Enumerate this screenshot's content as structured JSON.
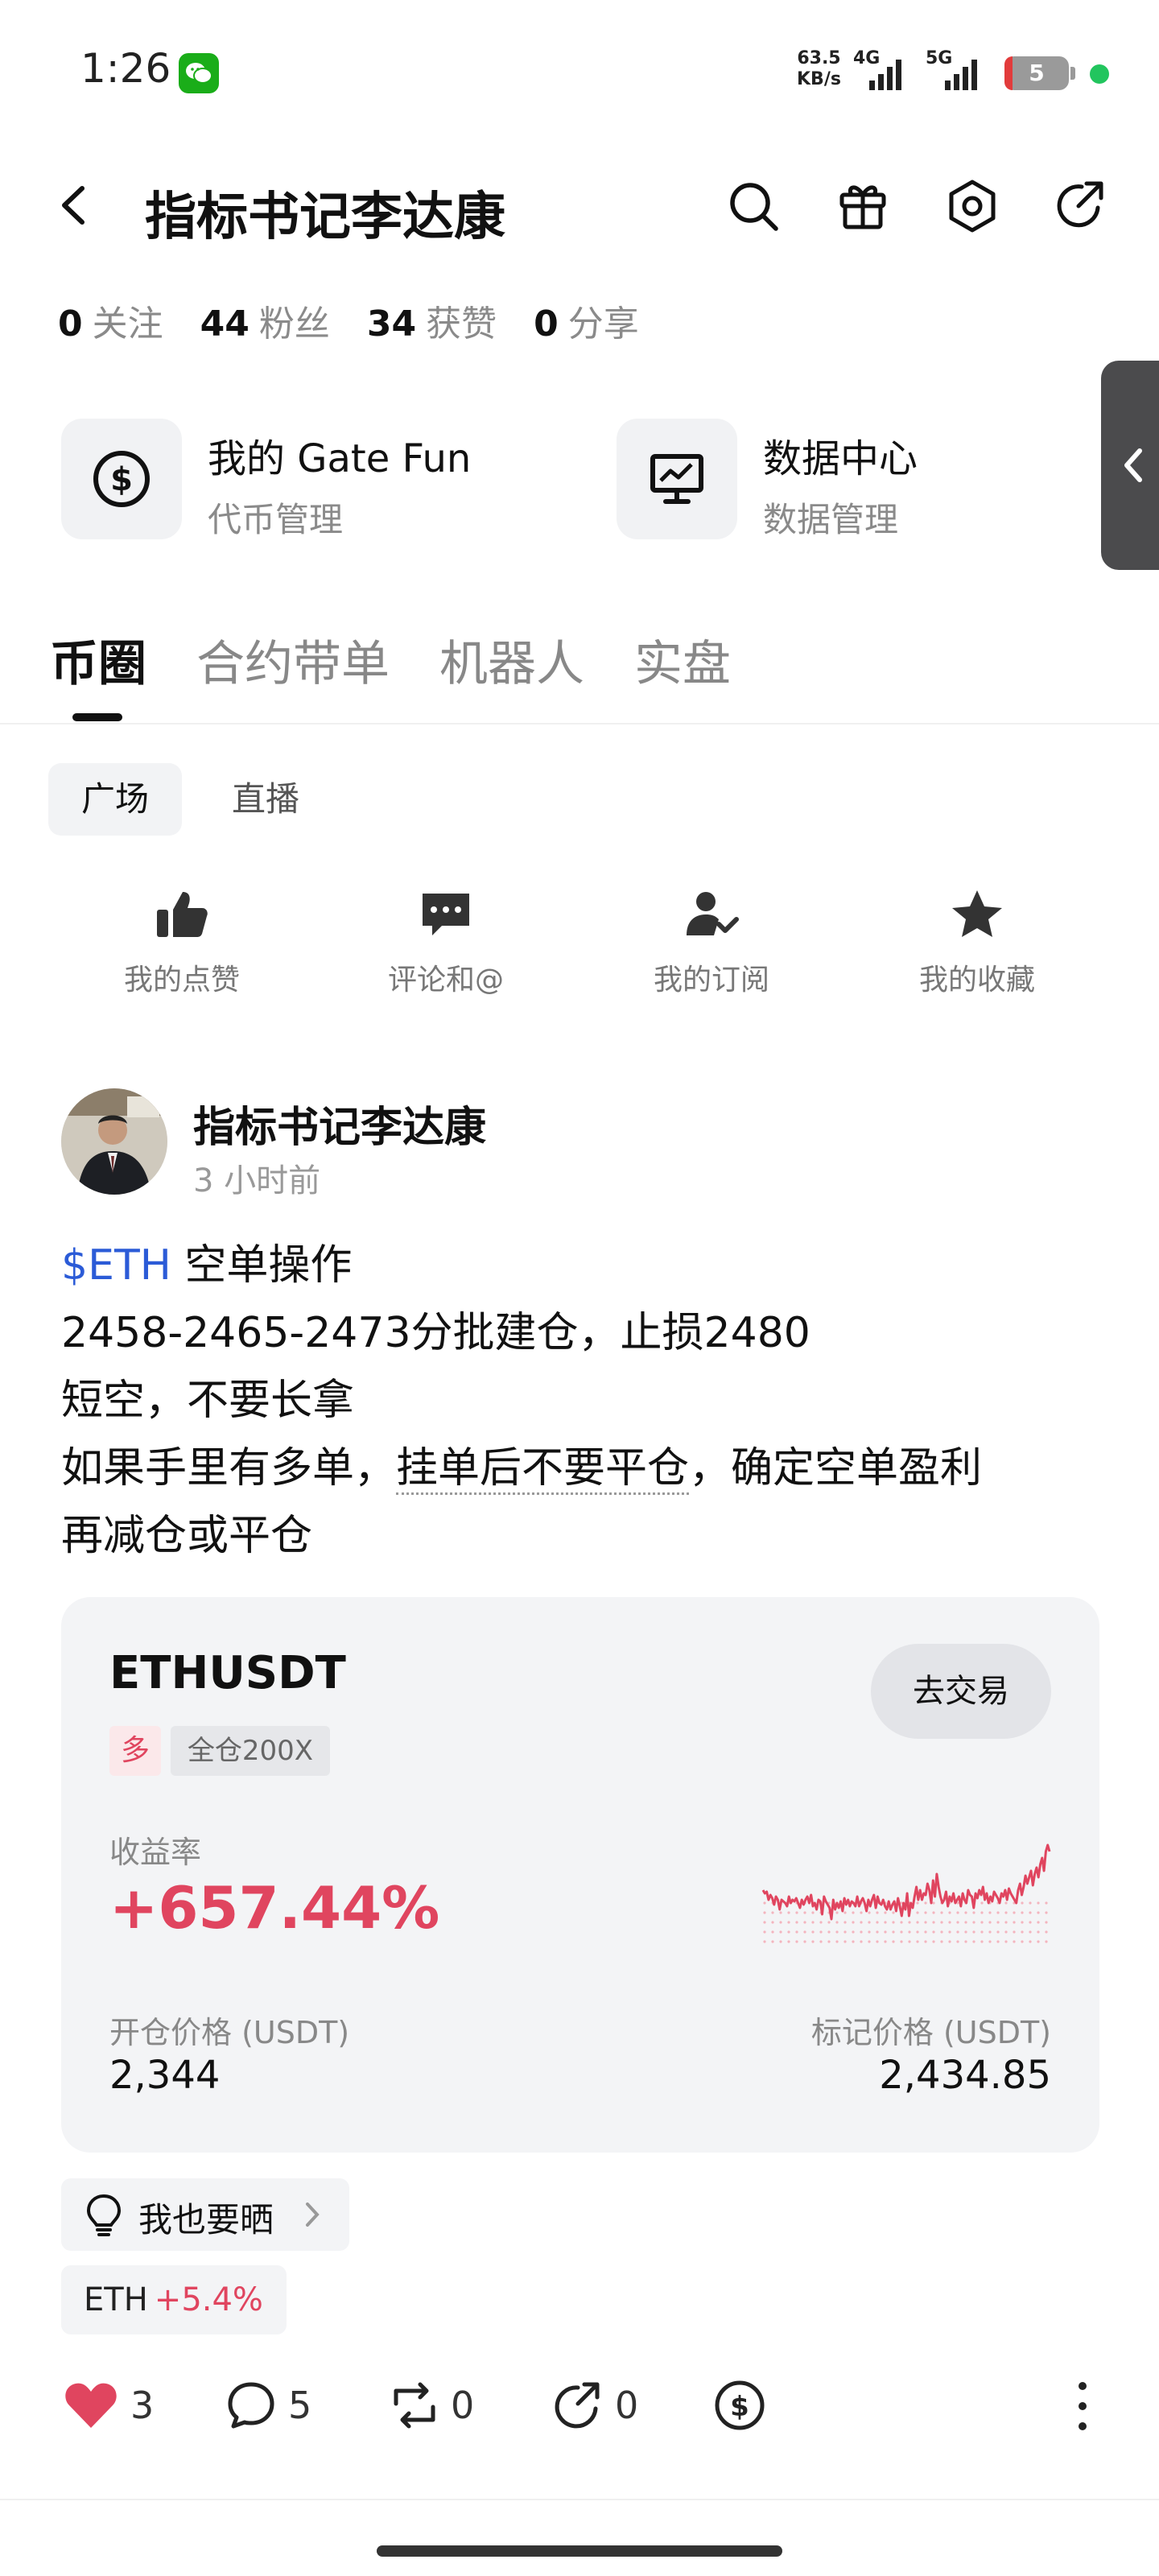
{
  "status_bar": {
    "time": "1:26",
    "net_speed_value": "63.5",
    "net_speed_unit": "KB/s",
    "signal_1": "4G",
    "signal_2": "5G",
    "battery": "5"
  },
  "header": {
    "title": "指标书记李达康"
  },
  "stats": [
    {
      "num": "0",
      "label": "关注"
    },
    {
      "num": "44",
      "label": "粉丝"
    },
    {
      "num": "34",
      "label": "获赞"
    },
    {
      "num": "0",
      "label": "分享"
    }
  ],
  "tools": [
    {
      "title": "我的 Gate Fun",
      "subtitle": "代币管理",
      "icon": "dollar-circle-icon"
    },
    {
      "title": "数据中心",
      "subtitle": "数据管理",
      "icon": "monitor-chart-icon"
    }
  ],
  "main_tabs": [
    "币圈",
    "合约带单",
    "机器人",
    "实盘"
  ],
  "sub_tabs": [
    "广场",
    "直播"
  ],
  "quick_actions": [
    {
      "label": "我的点赞",
      "icon": "thumbs-up-icon"
    },
    {
      "label": "评论和@",
      "icon": "comment-icon"
    },
    {
      "label": "我的订阅",
      "icon": "subscribe-icon"
    },
    {
      "label": "我的收藏",
      "icon": "star-icon"
    }
  ],
  "post": {
    "author": "指标书记李达康",
    "time": "3 小时前",
    "tag": "$ETH",
    "line1_rest": " 空单操作",
    "line2": "2458-2465-2473分批建仓，止损2480",
    "line3": "短空，不要长拿",
    "line4_a": "如果手里有多单，",
    "line4_b": "挂单后不要平仓",
    "line4_c": "，确定空单盈利",
    "line5": "再减仓或平仓"
  },
  "trade_card": {
    "pair": "ETHUSDT",
    "trade_button": "去交易",
    "side": "多",
    "margin": "全仓200X",
    "pnl_label": "收益率",
    "pnl_value": "+657.44%",
    "open_label": "开仓价格 (USDT)",
    "open_value": "2,344",
    "mark_label": "标记价格 (USDT)",
    "mark_value": "2,434.85",
    "accent_color": "#e0455f"
  },
  "chart_data": {
    "type": "line",
    "values": [
      46,
      44,
      45,
      40,
      43,
      41,
      37,
      42,
      40,
      34,
      40,
      39,
      38,
      36,
      42,
      38,
      40,
      39,
      41,
      38,
      35,
      40,
      37,
      40,
      42,
      38,
      43,
      36,
      38,
      34,
      40,
      39,
      31,
      42,
      39,
      37,
      35,
      28,
      40,
      34,
      38,
      35,
      39,
      33,
      41,
      37,
      40,
      36,
      39,
      38,
      36,
      42,
      36,
      39,
      41,
      38,
      33,
      40,
      36,
      40,
      43,
      35,
      42,
      38,
      37,
      40,
      36,
      34,
      39,
      34,
      37,
      39,
      33,
      41,
      36,
      30,
      38,
      34,
      44,
      30,
      38,
      35,
      42,
      48,
      40,
      46,
      40,
      44,
      43,
      50,
      46,
      38,
      52,
      42,
      56,
      48,
      42,
      38,
      40,
      45,
      36,
      42,
      39,
      44,
      38,
      40,
      42,
      36,
      44,
      40,
      38,
      46,
      43,
      42,
      35,
      44,
      41,
      46,
      43,
      48,
      40,
      44,
      38,
      42,
      39,
      45,
      43,
      41,
      38,
      44,
      42,
      46,
      40,
      47,
      44,
      42,
      40,
      38,
      46,
      50,
      43,
      48,
      55,
      50,
      54,
      58,
      49,
      56,
      60,
      54,
      62,
      66,
      58,
      70,
      74,
      70
    ],
    "color": "#e0455f"
  },
  "pills": {
    "show_label": "我也要晒",
    "eth_symbol": "ETH",
    "eth_change": "+5.4%"
  },
  "actions": {
    "likes": "3",
    "comments": "5",
    "reposts": "0",
    "shares": "0"
  }
}
